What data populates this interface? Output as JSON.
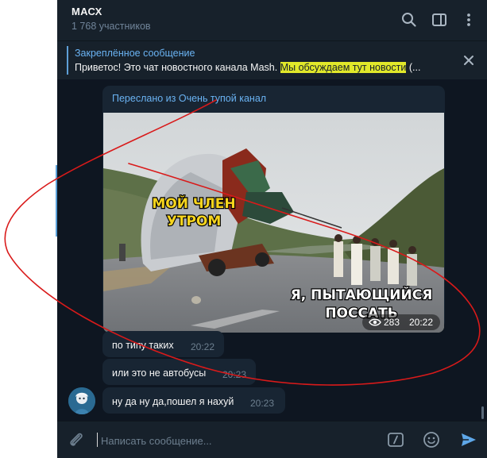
{
  "header": {
    "title": "МАСХ",
    "subtitle": "1 768 участников",
    "icons": [
      "search-icon",
      "sidebar-toggle-icon",
      "more-icon"
    ]
  },
  "pinned": {
    "title": "Закреплённое сообщение",
    "text_before": "Приветос! Это чат новостного канала Mash. ",
    "text_highlight": "Мы обсуждаем тут новости",
    "text_after": " (...",
    "close_icon": "close-icon"
  },
  "messages": {
    "forwarded": {
      "forward_label": "Переслано из Очень тупой канал",
      "meme_top": [
        "МОЙ ЧЛЕН",
        "УТРОМ"
      ],
      "meme_bottom": [
        "Я, ПЫТАЮЩИЙСЯ",
        "ПОССАТЬ"
      ],
      "views": "283",
      "time": "20:22"
    },
    "m1": {
      "text": "по типу таких",
      "time": "20:22"
    },
    "m2": {
      "text": "или это не автобусы",
      "time": "20:23"
    },
    "m3": {
      "text": "ну да ну да,пошел я нахуй",
      "time": "20:23"
    }
  },
  "composer": {
    "placeholder": "Написать сообщение...",
    "icons": [
      "attach-icon",
      "commands-icon",
      "emoji-icon",
      "send-icon"
    ]
  },
  "colors": {
    "background": "#0e1621",
    "panel": "#17212b",
    "bubble": "#182533",
    "accent": "#6ab3f3",
    "highlight": "#e1e82a",
    "scribble": "#d91a1a",
    "meme_yellow": "#f7d51d"
  }
}
